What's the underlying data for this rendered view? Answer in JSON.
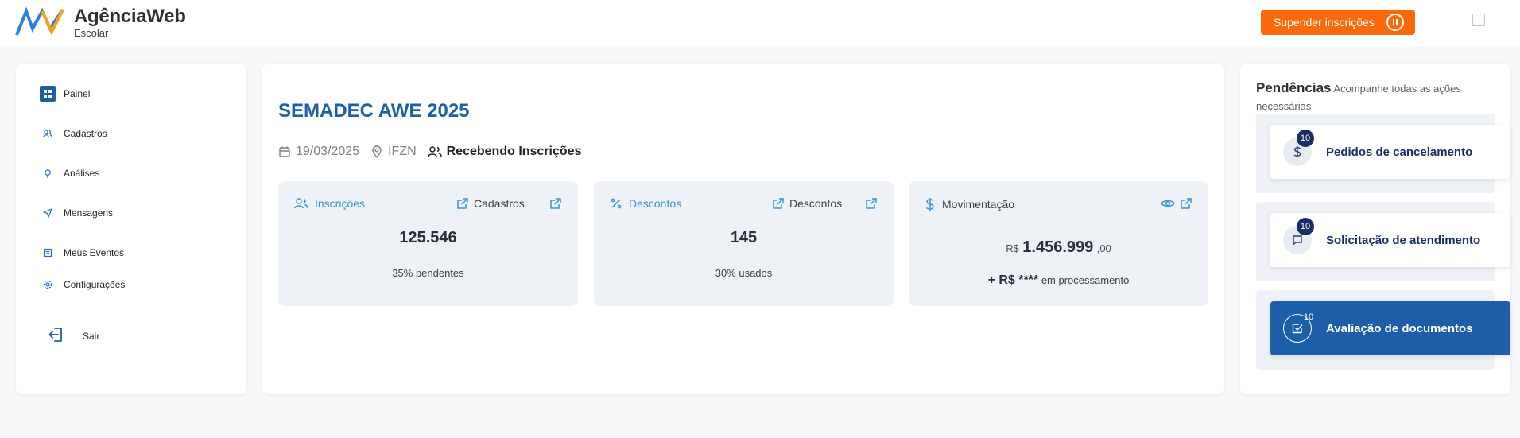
{
  "header": {
    "brand_name": "AgênciaWeb",
    "brand_sub": "Escolar",
    "suspend_label": "Supender inscrições"
  },
  "sidebar": {
    "items": [
      {
        "label": "Painel",
        "icon": "grid-icon"
      },
      {
        "label": "Cadastros",
        "icon": "users-icon"
      },
      {
        "label": "Análises",
        "icon": "lightbulb-icon"
      },
      {
        "label": "Mensagens",
        "icon": "send-icon"
      },
      {
        "label": "Meus Eventos",
        "icon": "list-icon"
      },
      {
        "label": "Configurações",
        "icon": "gear-icon"
      }
    ],
    "logout_label": "Sair"
  },
  "event": {
    "title": "SEMADEC AWE 2025",
    "date": "19/03/2025",
    "location": "IFZN",
    "status": "Recebendo Inscrições"
  },
  "stats": {
    "inscricoes": {
      "title": "Inscrições",
      "link": "Cadastros",
      "value": "125.546",
      "sub": "35% pendentes"
    },
    "descontos": {
      "title": "Descontos",
      "link": "Descontos",
      "value": "145",
      "sub": "30% usados"
    },
    "movimentacao": {
      "title": "Movimentação",
      "currency": "R$",
      "value": "1.456.999",
      "cents": ",00",
      "proc_value": "+ R$ ****",
      "proc_label": "em processamento"
    }
  },
  "pendencias": {
    "title": "Pendências",
    "subtitle": "Acompanhe todas as ações necessárias",
    "items": [
      {
        "label": "Pedidos de cancelamento",
        "count": "10",
        "icon": "dollar-icon"
      },
      {
        "label": "Solicitação de atendimento",
        "count": "10",
        "icon": "chat-icon"
      },
      {
        "label": "Avaliação de documentos",
        "count": "10",
        "icon": "check-square-icon"
      }
    ]
  },
  "colors": {
    "primary": "#1d5ea8",
    "accent_orange": "#fa6a0a",
    "link_blue": "#3a93d5",
    "navy": "#1b2d66"
  }
}
